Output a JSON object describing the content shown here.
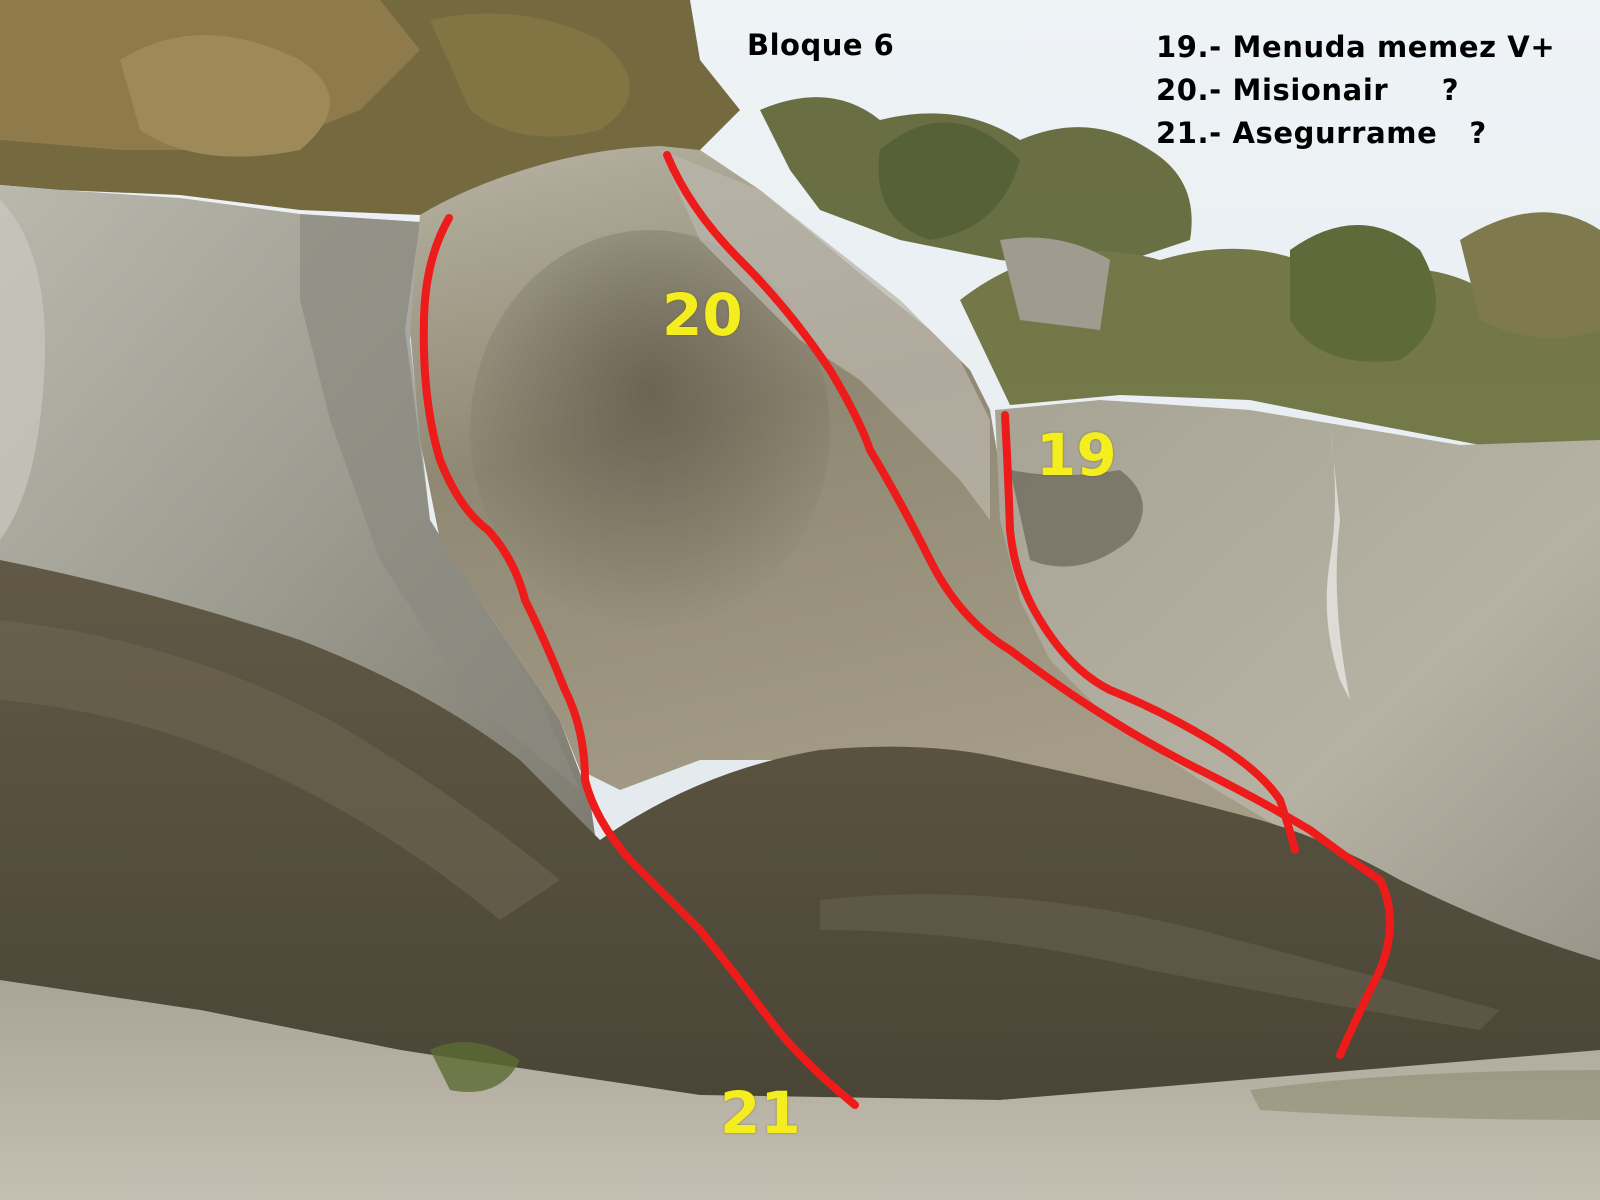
{
  "image": {
    "subject": "sandstone boulder topo with three marked climbing routes",
    "colors": {
      "route_line": "#ee1b1b",
      "route_number": "#f5ee1e",
      "caption_text": "#000000",
      "sky": "#e8eef2",
      "rock_light": "#a9a597",
      "rock_dark": "#57503f",
      "vegetation": "#6f6a3c",
      "ground": "#bdb7a8"
    }
  },
  "title": "Bloque 6",
  "legend": [
    {
      "text": "19.- Menuda memez V+"
    },
    {
      "text": "20.- Misionair     ?"
    },
    {
      "text": "21.- Asegurrame   ?"
    }
  ],
  "route_labels": {
    "r19": "19",
    "r20": "20",
    "r21": "21"
  }
}
